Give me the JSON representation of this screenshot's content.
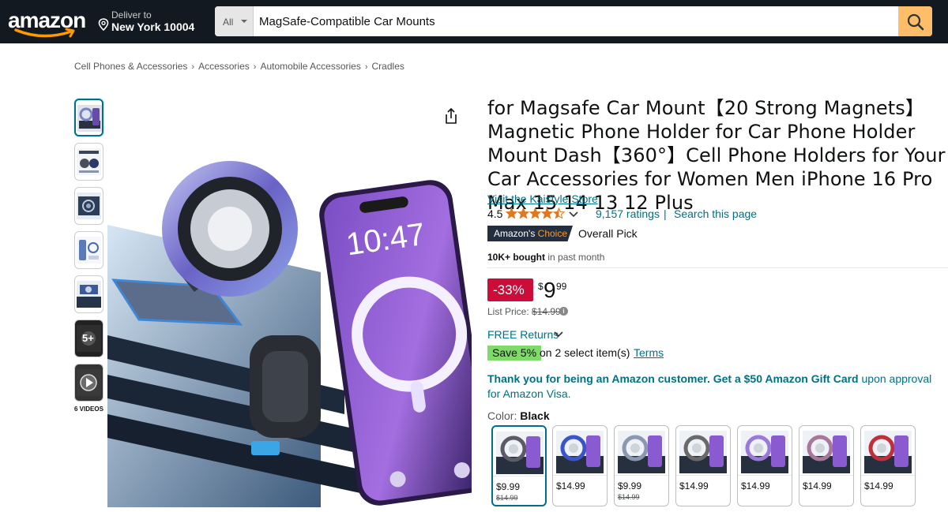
{
  "header": {
    "logo_text": "amazon",
    "deliver_line1": "Deliver to",
    "deliver_line2": "New York 10004",
    "search_category": "All",
    "search_value": "MagSafe-Compatible Car Mounts",
    "icons": [
      "location-pin-icon",
      "search-icon"
    ]
  },
  "breadcrumb": [
    "Cell Phones & Accessories",
    "Accessories",
    "Automobile Accessories",
    "Cradles"
  ],
  "gallery": {
    "thumb_count": 7,
    "more_label": "5+",
    "videos_label": "6 VIDEOS"
  },
  "product": {
    "title": "for Magsafe Car Mount【20 Strong Magnets】Magnetic Phone Holder for Car Phone Holder Mount Dash【360°】Cell Phone Holders for Your Car Accessories for Women Men iPhone 16 Pro Max 15 14 13 12 Plus",
    "store_link": "Visit the Kaistyle Store",
    "rating_value": "4.5",
    "rating_stars": 4.5,
    "ratings_count": "9,157 ratings",
    "separator": "|",
    "search_page": "Search this page",
    "badge_part1": "Amazon's",
    "badge_part2": "Choice",
    "badge_text": "Overall Pick",
    "bought_bold": "10K+ bought",
    "bought_rest": "in past month"
  },
  "pricing": {
    "discount": "-33%",
    "currency": "$",
    "whole": "9",
    "fraction": "99",
    "list_label": "List Price:",
    "list_price": "$14.99",
    "returns": "FREE Returns",
    "save_badge": "Save 5%",
    "save_text": "on 2 select item(s)",
    "terms": "Terms"
  },
  "offer": {
    "bold": "Thank you for being an Amazon customer. Get a $50 Amazon Gift Card",
    "rest": "upon approval for Amazon Visa."
  },
  "color": {
    "label": "Color:",
    "selected": "Black",
    "swatches": [
      {
        "price": "$9.99",
        "list": "$14.99",
        "ring": "#5a5a68"
      },
      {
        "price": "$14.99",
        "list": "",
        "ring": "#3b55c8"
      },
      {
        "price": "$9.99",
        "list": "$14.99",
        "ring": "#8a98b0"
      },
      {
        "price": "$14.99",
        "list": "",
        "ring": "#6a6a6a"
      },
      {
        "price": "$14.99",
        "list": "",
        "ring": "#9a7ad8"
      },
      {
        "price": "$14.99",
        "list": "",
        "ring": "#a7789a"
      },
      {
        "price": "$14.99",
        "list": "",
        "ring": "#c0303a"
      }
    ]
  },
  "colors": {
    "header_bg": "#131921",
    "search_button": "#febd69",
    "link": "#007185",
    "discount": "#cc0c39",
    "save": "#7fda69",
    "star": "#de7921"
  }
}
